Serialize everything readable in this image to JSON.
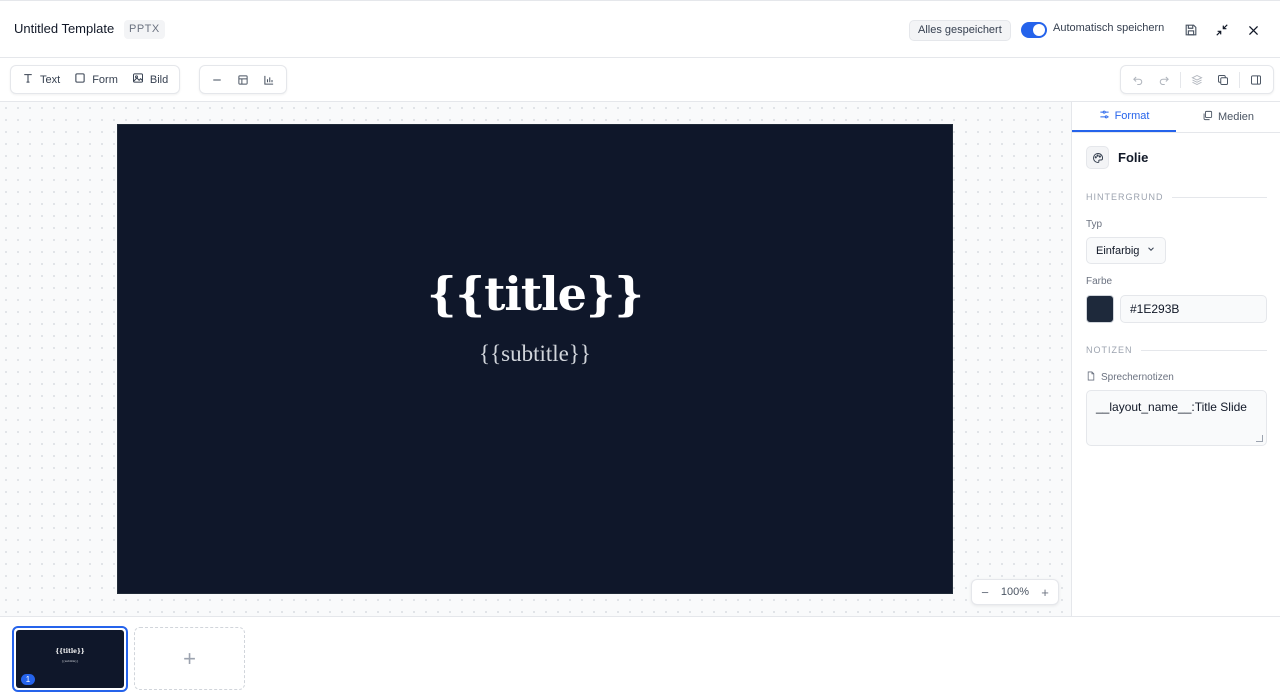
{
  "header": {
    "title": "Untitled Template",
    "format": "PPTX",
    "saved_status": "Alles gespeichert",
    "autosave_label": "Automatisch speichern",
    "autosave_on": true,
    "icons": [
      "save-icon",
      "collapse-icon",
      "close-icon"
    ]
  },
  "toolbar": {
    "text_label": "Text",
    "shape_label": "Form",
    "image_label": "Bild",
    "icons": [
      "line-icon",
      "table-icon",
      "chart-icon",
      "undo-icon",
      "redo-icon",
      "layers-icon",
      "duplicate-icon",
      "panel-toggle-icon"
    ]
  },
  "slide": {
    "title": "{{title}}",
    "subtitle": "{{subtitle}}",
    "background": "#0F172A"
  },
  "zoom": {
    "level": "100%",
    "minus": "−",
    "plus": "+"
  },
  "panel": {
    "tabs": [
      {
        "label": "Format",
        "active": true
      },
      {
        "label": "Medien",
        "active": false
      }
    ],
    "heading": "Folie",
    "background_section": "HINTERGRUND",
    "type_label": "Typ",
    "type_value": "Einfarbig",
    "color_label": "Farbe",
    "color_value": "#1E293B",
    "notes_section": "NOTIZEN",
    "notes_label": "Sprechernotizen",
    "notes_value": "__layout_name__:Title Slide"
  },
  "slides_strip": {
    "slides": [
      {
        "number": "1",
        "title": "{{title}}",
        "subtitle": "{{subtitle}}"
      }
    ],
    "add_label": "+"
  },
  "colors": {
    "accent": "#2563EB",
    "slide_bg": "#0F172A",
    "swatch": "#1E293B"
  }
}
